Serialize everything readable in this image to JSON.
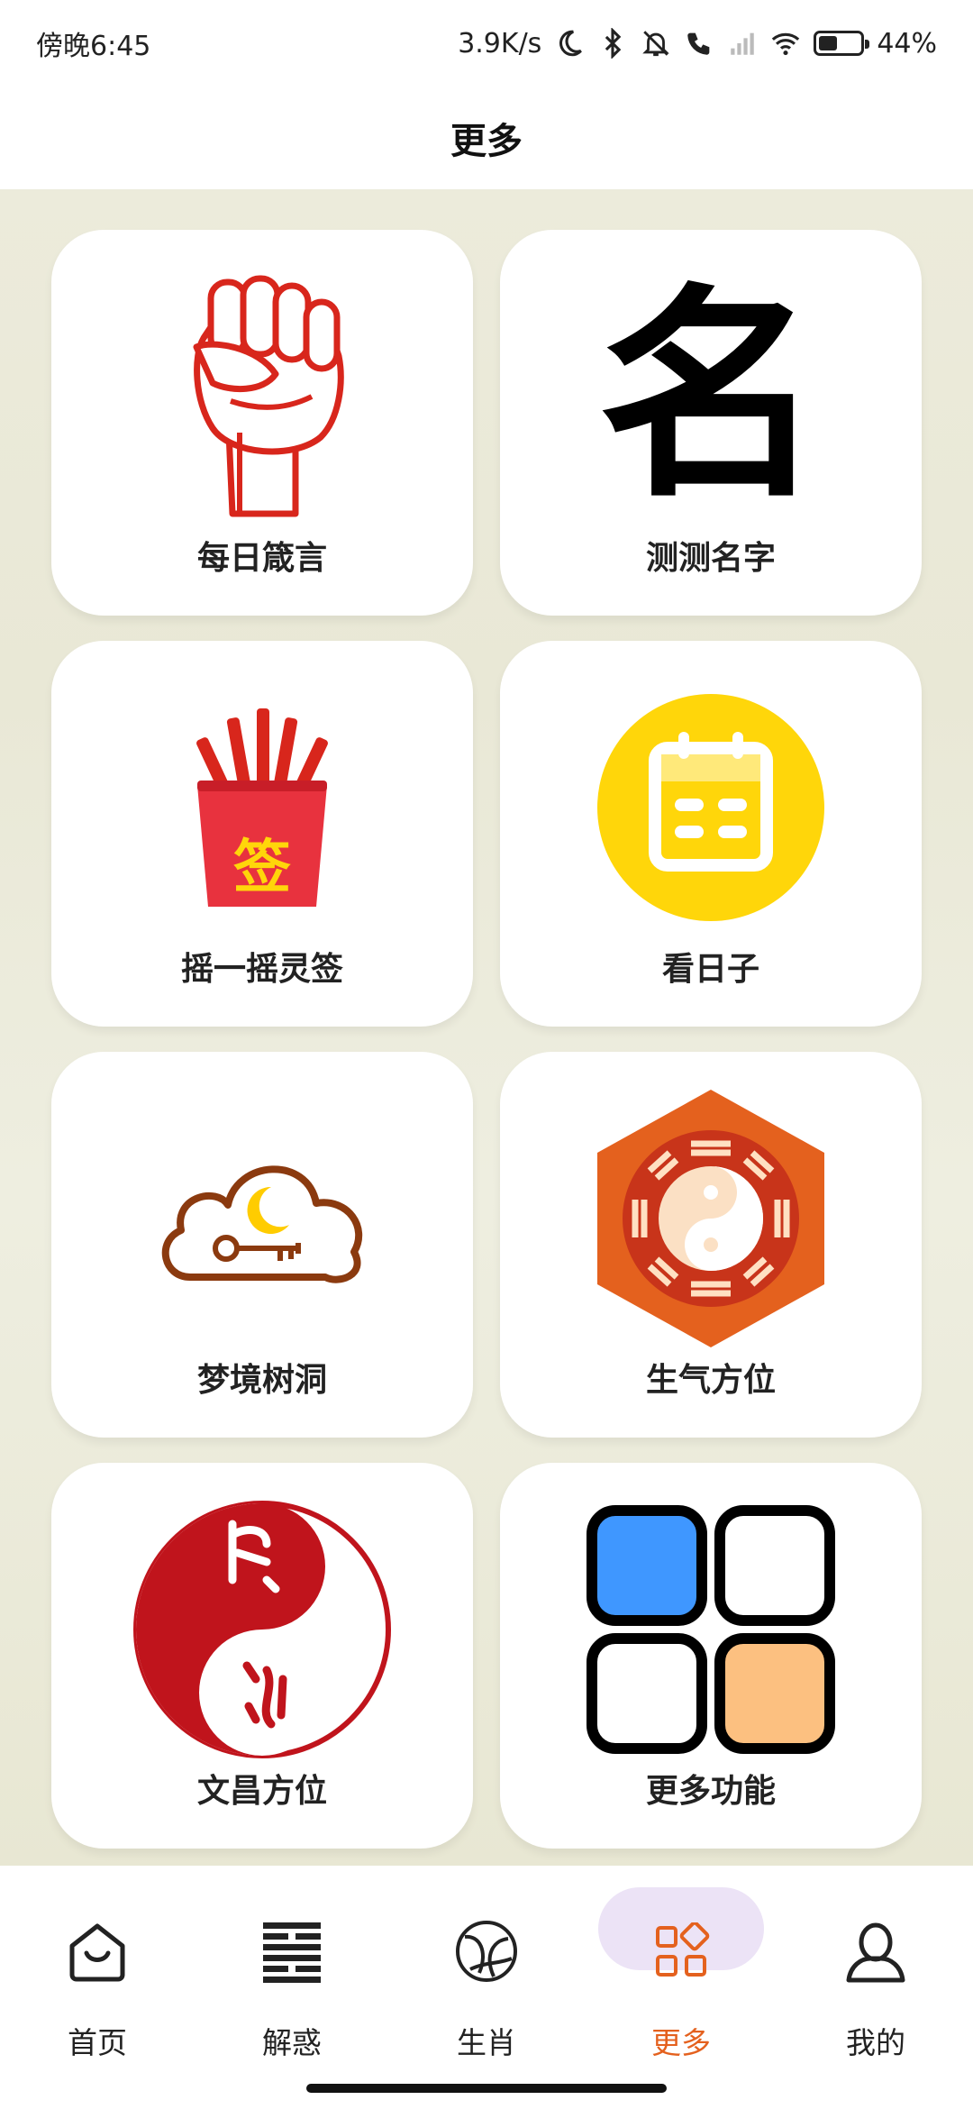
{
  "status": {
    "time": "傍晚6:45",
    "net_speed": "3.9K/s",
    "battery": "44%"
  },
  "page": {
    "title": "更多"
  },
  "grid": [
    {
      "label": "每日箴言",
      "icon": "fist-icon"
    },
    {
      "label": "测测名字",
      "icon": "name-character-icon"
    },
    {
      "label": "摇一摇灵签",
      "icon": "fortune-sticks-icon"
    },
    {
      "label": "看日子",
      "icon": "calendar-icon"
    },
    {
      "label": "梦境树洞",
      "icon": "dream-cloud-icon"
    },
    {
      "label": "生气方位",
      "icon": "bagua-icon"
    },
    {
      "label": "文昌方位",
      "icon": "yin-yang-icon"
    },
    {
      "label": "更多功能",
      "icon": "more-grid-icon"
    }
  ],
  "icon_text": {
    "name_char": "名",
    "stick_char": "签"
  },
  "nav": [
    {
      "label": "首页",
      "icon": "home-icon"
    },
    {
      "label": "解惑",
      "icon": "hexagram-icon"
    },
    {
      "label": "生肖",
      "icon": "zodiac-icon"
    },
    {
      "label": "更多",
      "icon": "more-apps-icon",
      "active": true
    },
    {
      "label": "我的",
      "icon": "profile-icon"
    }
  ],
  "colors": {
    "accent": "#e4611e",
    "active_pill": "#ece3f6",
    "red": "#d8261c",
    "yellow": "#ffd60a"
  }
}
